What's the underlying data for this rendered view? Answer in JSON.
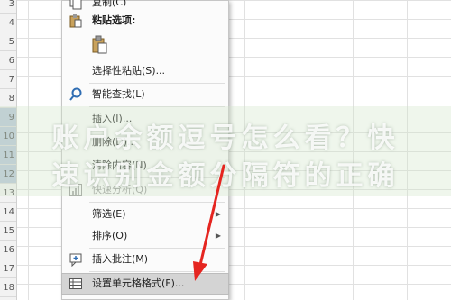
{
  "spreadsheet": {
    "row_numbers": [
      "3",
      "4",
      "5",
      "6",
      "7",
      "8",
      "9",
      "10",
      "11",
      "12",
      "13",
      "14",
      "15",
      "16",
      "17",
      "18"
    ]
  },
  "context_menu": {
    "copy": {
      "label": "复制(C)",
      "icon": "copy-icon"
    },
    "paste_options": {
      "label": "粘贴选项:",
      "icon": "paste-icon"
    },
    "paste_special": {
      "label": "选择性粘贴(S)..."
    },
    "smart_lookup": {
      "label": "智能查找(L)",
      "icon": "search-icon"
    },
    "insert": {
      "label": "插入(I)..."
    },
    "delete": {
      "label": "删除(D)..."
    },
    "clear_contents": {
      "label": "清除内容(N)"
    },
    "quick_analysis": {
      "label": "快速分析(Q)",
      "icon": "quick-analysis-icon"
    },
    "filter": {
      "label": "筛选(E)",
      "arrow": "▶"
    },
    "sort": {
      "label": "排序(O)",
      "arrow": "▶"
    },
    "insert_comment": {
      "label": "插入批注(M)",
      "icon": "comment-icon"
    },
    "format_cells": {
      "label": "设置单元格格式(F)...",
      "icon": "format-cells-icon"
    }
  },
  "overlay": {
    "watermark_line1": "账户余额逗号怎么看？快",
    "watermark_line2": "速识别金额分隔符的正确"
  },
  "colors": {
    "arrow": "#e52520",
    "highlight": "#d4d4d4"
  }
}
